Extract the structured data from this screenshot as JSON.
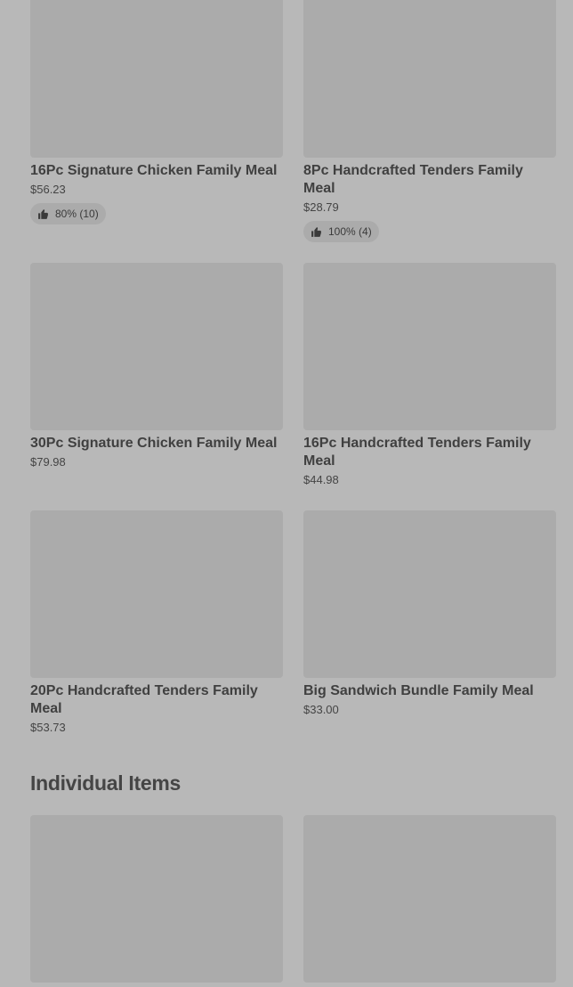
{
  "family_meals": [
    {
      "title": "16Pc Signature Chicken Family Meal",
      "price": "$56.23",
      "rating": "80% (10)"
    },
    {
      "title": "8Pc Handcrafted Tenders Family Meal",
      "price": "$28.79",
      "rating": "100% (4)"
    },
    {
      "title": "30Pc Signature Chicken Family Meal",
      "price": "$79.98"
    },
    {
      "title": "16Pc Handcrafted Tenders Family Meal",
      "price": "$44.98"
    },
    {
      "title": "20Pc Handcrafted Tenders Family Meal",
      "price": "$53.73"
    },
    {
      "title": "Big Sandwich Bundle Family Meal",
      "price": "$33.00"
    }
  ],
  "section": {
    "title": "Individual Items"
  },
  "icons": {
    "rating": "thumbs-up-icon"
  }
}
